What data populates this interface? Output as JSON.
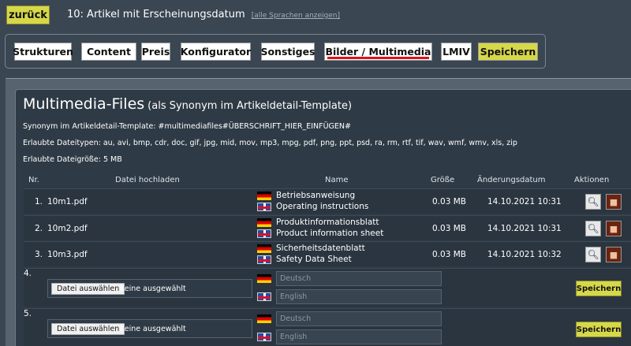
{
  "header": {
    "back_label": "zurück",
    "title": "10: Artikel mit Erscheinungsdatum",
    "lang_link": "[alle Sprachen anzeigen]"
  },
  "tabs": [
    "Strukturen",
    "Content",
    "Preis",
    "Konfigurator",
    "Sonstiges",
    "Bilder / Multimedia",
    "LMIV",
    "Speichern"
  ],
  "section": {
    "title": "Multimedia-Files",
    "subtitle": "(als Synonym im Artikeldetail-Template)",
    "synonym": "Synonym im Artikeldetail-Template: #multimediafiles#ÜBERSCHRIFT_HIER_EINFÜGEN#",
    "types": "Erlaubte Dateitypen: au, avi, bmp, cdr, doc, gif, jpg, mid, mov, mp3, mpg, pdf, png, ppt, psd, ra, rm, rtf, tif, wav, wmf, wmv, xls, zip",
    "size": "Erlaubte Dateigröße: 5 MB"
  },
  "table": {
    "headers": [
      "Nr.",
      "Datei hochladen",
      "Name",
      "Größe",
      "Änderungsdatum",
      "Aktionen"
    ],
    "rows": [
      {
        "nr": "1.",
        "file": "10m1.pdf",
        "de": "Betriebsanweisung",
        "en": "Operating instructions",
        "size": "0.03 MB",
        "date": "14.10.2021 10:31"
      },
      {
        "nr": "2.",
        "file": "10m2.pdf",
        "de": "Produktinformationsblatt",
        "en": "Product information sheet",
        "size": "0.03 MB",
        "date": "14.10.2021 10:31"
      },
      {
        "nr": "3.",
        "file": "10m3.pdf",
        "de": "Sicherheitsdatenblatt",
        "en": "Safety Data Sheet",
        "size": "0.03 MB",
        "date": "14.10.2021 10:32"
      }
    ],
    "uploads": [
      {
        "nr": "4.",
        "choose": "Datei auswählen",
        "nofile": "Keine ausgewählt",
        "de_ph": "Deutsch",
        "en_ph": "English",
        "save": "Speichern"
      },
      {
        "nr": "5.",
        "choose": "Datei auswählen",
        "nofile": "Keine ausgewählt",
        "de_ph": "Deutsch",
        "en_ph": "English",
        "save": "Speichern"
      }
    ]
  }
}
